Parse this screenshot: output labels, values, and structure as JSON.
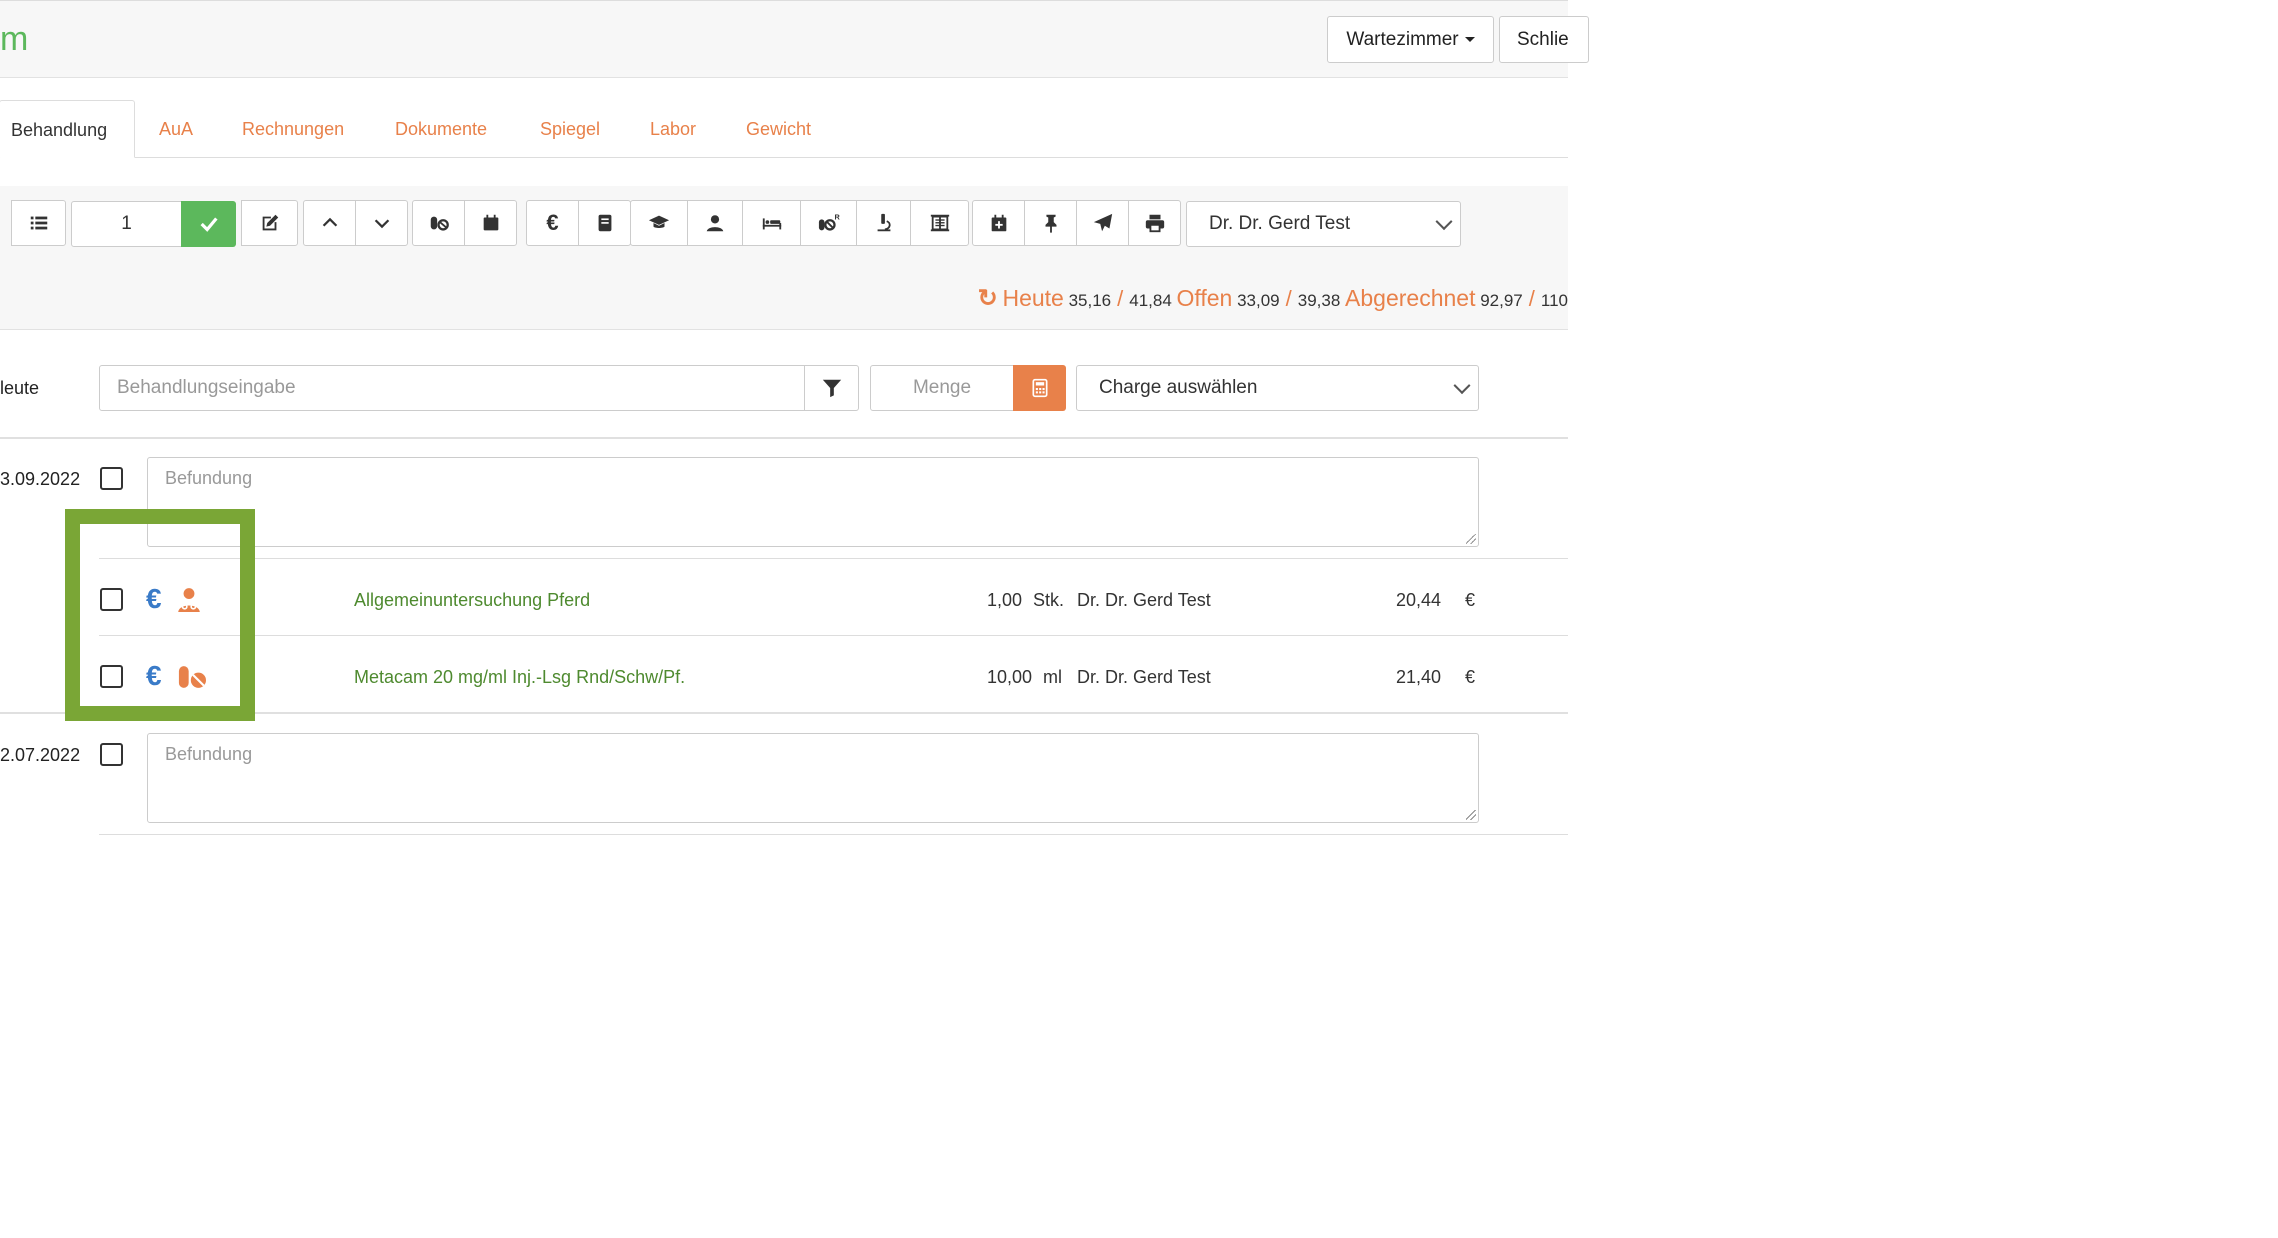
{
  "header": {
    "title": "m",
    "wartezimmer_label": "Wartezimmer",
    "close_label": "Schlie"
  },
  "tabs": [
    "Behandlung",
    "AuA",
    "Rechnungen",
    "Dokumente",
    "Spiegel",
    "Labor",
    "Gewicht"
  ],
  "toolbar": {
    "count_value": "1",
    "doctor_select": "Dr. Dr. Gerd Test"
  },
  "stats": {
    "heute_label": "Heute",
    "heute_a": "35,16",
    "heute_b": "41,84",
    "offen_label": "Offen",
    "offen_a": "33,09",
    "offen_b": "39,38",
    "abgerechnet_label": "Abgerechnet",
    "abgerechnet_a": "92,97",
    "abgerechnet_b": "110"
  },
  "entry": {
    "date_label": "leute",
    "treatment_placeholder": "Behandlungseingabe",
    "menge_placeholder": "Menge",
    "charge_select": "Charge auswählen"
  },
  "records": [
    {
      "date": "3.09.2022",
      "befund_placeholder": "Befundung",
      "items": [
        {
          "name": "Allgemeinuntersuchung Pferd",
          "qty": "1,00",
          "unit": "Stk.",
          "doctor": "Dr. Dr. Gerd Test",
          "price": "20,44",
          "currency": "€",
          "icon": "doctor-icon"
        },
        {
          "name": "Metacam 20 mg/ml Inj.-Lsg Rnd/Schw/Pf.",
          "qty": "10,00",
          "unit": "ml",
          "doctor": "Dr. Dr. Gerd Test",
          "price": "21,40",
          "currency": "€",
          "icon": "pills-icon"
        }
      ]
    },
    {
      "date": "2.07.2022",
      "befund_placeholder": "Befundung"
    }
  ],
  "colors": {
    "accent_orange": "#e8814a",
    "brand_green": "#5cb85c",
    "item_green": "#4e8a2f",
    "euro_blue": "#3a7bc8",
    "highlight_green": "#7aa636"
  }
}
